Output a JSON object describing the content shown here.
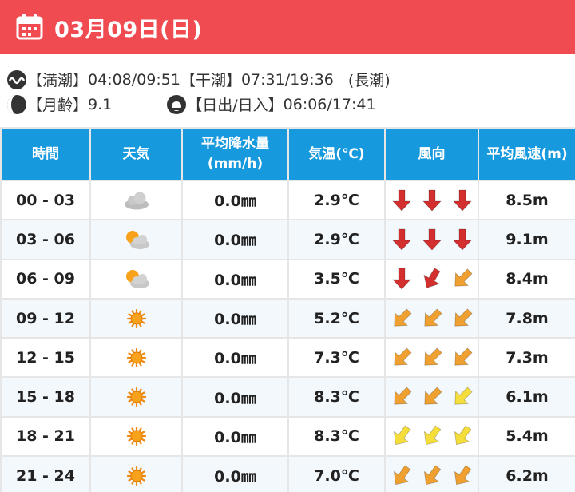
{
  "header": {
    "date": "03月09日(日)"
  },
  "tide": {
    "high_label": "【満潮】",
    "high_times": "04:08/09:51",
    "low_label": "【干潮】",
    "low_times": "07:31/19:36",
    "type": "(長潮)"
  },
  "moon": {
    "label": "【月齢】",
    "age": "9.1"
  },
  "sun": {
    "label": "【日出/日入】",
    "times": "06:06/17:41"
  },
  "table": {
    "headers": [
      "時間",
      "天気",
      "平均降水量\n(mm/h)",
      "気温(℃)",
      "風向",
      "平均風速(m)"
    ],
    "rows": [
      {
        "time": "00 - 03",
        "weather": "cloudy",
        "rain": "0.0㎜",
        "temp": "2.9℃",
        "wind": [
          [
            "#d32f2f",
            180
          ],
          [
            "#d32f2f",
            180
          ],
          [
            "#d32f2f",
            180
          ]
        ],
        "speed": "8.5m"
      },
      {
        "time": "03 - 06",
        "weather": "partly-cloudy",
        "rain": "0.0㎜",
        "temp": "2.9℃",
        "wind": [
          [
            "#d32f2f",
            180
          ],
          [
            "#d32f2f",
            180
          ],
          [
            "#d32f2f",
            180
          ]
        ],
        "speed": "9.1m"
      },
      {
        "time": "06 - 09",
        "weather": "partly-cloudy",
        "rain": "0.0㎜",
        "temp": "3.5℃",
        "wind": [
          [
            "#d32f2f",
            180
          ],
          [
            "#d32f2f",
            210
          ],
          [
            "#f0a030",
            225
          ]
        ],
        "speed": "8.4m"
      },
      {
        "time": "09 - 12",
        "weather": "sunny",
        "rain": "0.0㎜",
        "temp": "5.2℃",
        "wind": [
          [
            "#f0a030",
            225
          ],
          [
            "#f0a030",
            225
          ],
          [
            "#f0a030",
            225
          ]
        ],
        "speed": "7.8m"
      },
      {
        "time": "12 - 15",
        "weather": "sunny",
        "rain": "0.0㎜",
        "temp": "7.3℃",
        "wind": [
          [
            "#f0a030",
            225
          ],
          [
            "#f0a030",
            225
          ],
          [
            "#f0a030",
            225
          ]
        ],
        "speed": "7.3m"
      },
      {
        "time": "15 - 18",
        "weather": "sunny",
        "rain": "0.0㎜",
        "temp": "8.3℃",
        "wind": [
          [
            "#f0a030",
            225
          ],
          [
            "#f0a030",
            225
          ],
          [
            "#f5dd3a",
            225
          ]
        ],
        "speed": "6.1m"
      },
      {
        "time": "18 - 21",
        "weather": "sunny",
        "rain": "0.0㎜",
        "temp": "8.3℃",
        "wind": [
          [
            "#f5dd3a",
            215
          ],
          [
            "#f5dd3a",
            215
          ],
          [
            "#f5dd3a",
            215
          ]
        ],
        "speed": "5.4m"
      },
      {
        "time": "21 - 24",
        "weather": "sunny",
        "rain": "0.0㎜",
        "temp": "7.0℃",
        "wind": [
          [
            "#f0a030",
            215
          ],
          [
            "#f0a030",
            215
          ],
          [
            "#f0a030",
            215
          ]
        ],
        "speed": "6.2m"
      }
    ]
  }
}
